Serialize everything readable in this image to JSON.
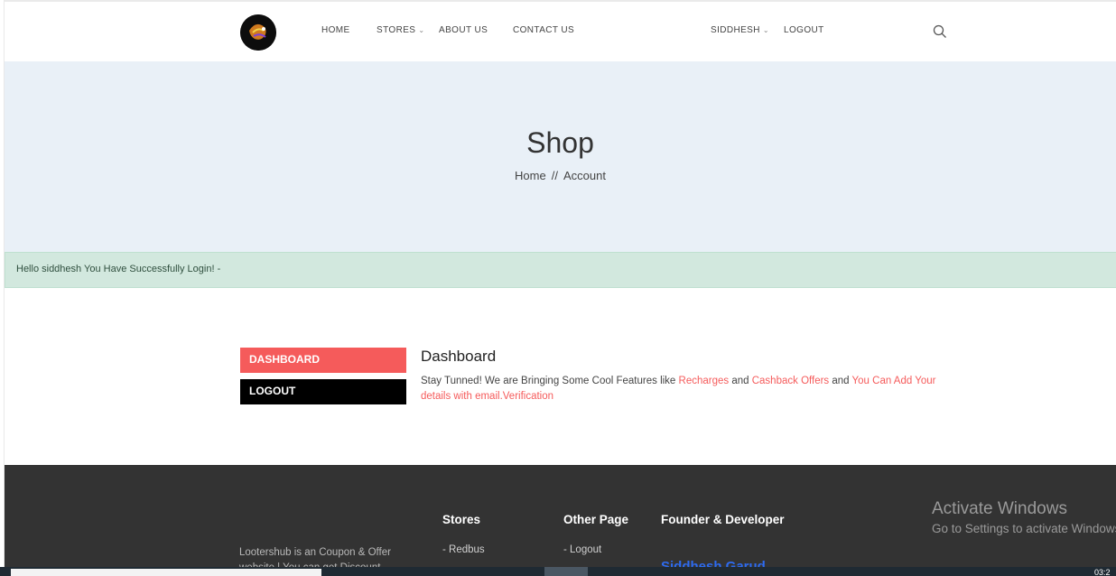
{
  "header": {
    "nav": [
      "HOME",
      "STORES",
      "ABOUT US",
      "CONTACT US"
    ],
    "user": "SIDDHESH",
    "logout": "LOGOUT"
  },
  "hero": {
    "title": "Shop",
    "breadcrumb": [
      "Home",
      "//",
      "Account"
    ]
  },
  "alert": {
    "text": "Hello siddhesh You Have Successfully Login! -"
  },
  "sidebar": {
    "items": [
      "DASHBOARD",
      "LOGOUT"
    ]
  },
  "content": {
    "title": "Dashboard",
    "text_1": "Stay Tunned! We are Bringing Some Cool Features like ",
    "link_1": "Recharges",
    "text_2": " and ",
    "link_2": "Cashback Offers",
    "text_3": " and ",
    "link_3": "You Can Add Your details with email.Verification"
  },
  "footer": {
    "desc": "Lootershub is an Coupon & Offer website | You can get Discount",
    "stores_title": "Stores",
    "stores_link": "- Redbus",
    "other_title": "Other Page",
    "other_link": "- Logout",
    "founder_title": "Founder & Developer",
    "founder_name": "Siddhesh Garud"
  },
  "windows": {
    "activate_title": "Activate Windows",
    "activate_sub": "Go to Settings to activate Windows.",
    "clock": "03:2"
  },
  "icons": {
    "logo": "logo-icon",
    "search": "search-icon",
    "chevron": "chevron-down-icon"
  },
  "colors": {
    "accent": "#f55b5b",
    "hero_bg": "#e9f0f7",
    "alert_bg": "#d2e8de",
    "footer_bg": "#333333",
    "founder_link": "#2d6bf0"
  }
}
